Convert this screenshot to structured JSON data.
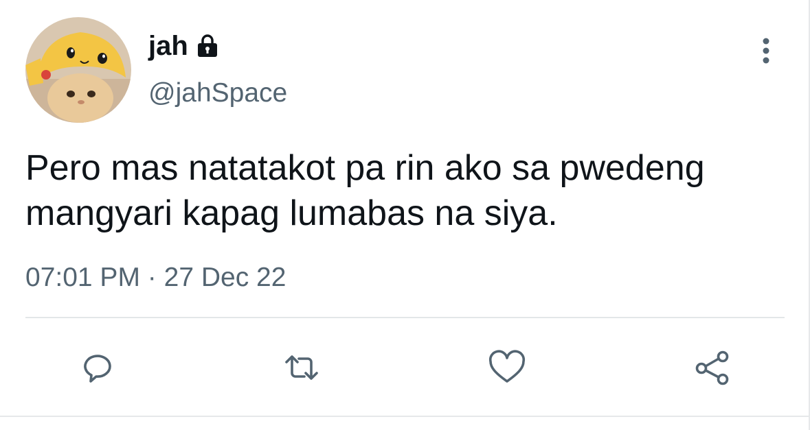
{
  "author": {
    "display_name": "jah",
    "handle": "@jahSpace",
    "protected_icon": "lock-icon",
    "avatar_description_icon": "avatar-image"
  },
  "tweet": {
    "text": "Pero mas natatakot pa rin ako sa pwedeng mangyari kapag lumabas na siya.",
    "time": "07:01 PM",
    "separator": "·",
    "date": "27 Dec 22"
  },
  "actions": [
    {
      "name": "reply",
      "icon": "comment-icon"
    },
    {
      "name": "retweet",
      "icon": "retweet-icon"
    },
    {
      "name": "like",
      "icon": "heart-icon"
    },
    {
      "name": "share",
      "icon": "share-icon"
    }
  ],
  "menu": {
    "icon": "more-vertical-icon"
  },
  "colors": {
    "text_primary": "#0f1419",
    "text_secondary": "#536471",
    "icon_gray": "#536471",
    "divider": "#e3e6e8"
  }
}
